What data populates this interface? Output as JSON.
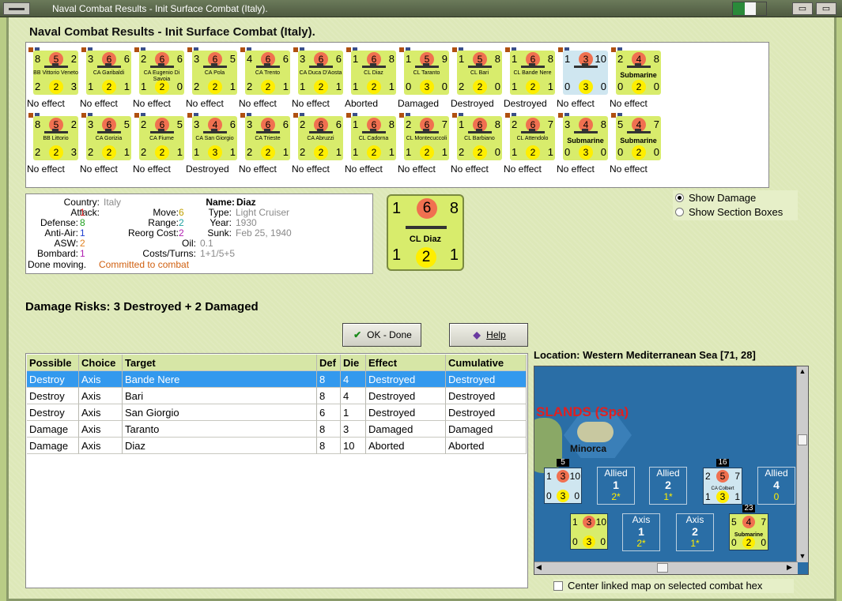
{
  "window": {
    "title": "Naval Combat Results - Init Surface Combat (Italy)."
  },
  "page": {
    "title": "Naval Combat Results - Init Surface Combat (Italy)."
  },
  "colors": {
    "accent": "#3399ee",
    "counter_axis": "#d8ec6c",
    "panel_bg": "#dde8b8"
  },
  "units": [
    {
      "name": "BB Vittorio Veneto",
      "tl": "8",
      "tc": "5",
      "tr": "2",
      "bl": "2",
      "bc": "2",
      "br": "3",
      "result": "No effect"
    },
    {
      "name": "CA Garibaldi",
      "tl": "3",
      "tc": "6",
      "tr": "6",
      "bl": "1",
      "bc": "2",
      "br": "1",
      "result": "No effect"
    },
    {
      "name": "CA Eugenio Di Savoia",
      "tl": "2",
      "tc": "6",
      "tr": "6",
      "bl": "1",
      "bc": "2",
      "br": "0",
      "result": "No effect"
    },
    {
      "name": "CA Pola",
      "tl": "3",
      "tc": "6",
      "tr": "5",
      "bl": "2",
      "bc": "2",
      "br": "1",
      "result": "No effect"
    },
    {
      "name": "CA Trento",
      "tl": "4",
      "tc": "6",
      "tr": "6",
      "bl": "2",
      "bc": "2",
      "br": "1",
      "result": "No effect"
    },
    {
      "name": "CA Duca D'Aosta",
      "tl": "3",
      "tc": "6",
      "tr": "6",
      "bl": "1",
      "bc": "2",
      "br": "1",
      "result": "No effect"
    },
    {
      "name": "CL Diaz",
      "tl": "1",
      "tc": "6",
      "tr": "8",
      "bl": "1",
      "bc": "2",
      "br": "1",
      "result": "Aborted"
    },
    {
      "name": "CL Taranto",
      "tl": "1",
      "tc": "5",
      "tr": "9",
      "bl": "0",
      "bc": "3",
      "br": "0",
      "result": "Damaged"
    },
    {
      "name": "CL Bari",
      "tl": "1",
      "tc": "5",
      "tr": "8",
      "bl": "2",
      "bc": "2",
      "br": "0",
      "result": "Destroyed"
    },
    {
      "name": "CL Bande Nere",
      "tl": "1",
      "tc": "6",
      "tr": "8",
      "bl": "1",
      "bc": "2",
      "br": "1",
      "result": "Destroyed"
    },
    {
      "name": "",
      "tl": "1",
      "tc": "3",
      "tr": "10",
      "bl": "0",
      "bc": "3",
      "br": "0",
      "result": "No effect"
    },
    {
      "name": "Submarine",
      "tl": "2",
      "tc": "4",
      "tr": "8",
      "bl": "0",
      "bc": "2",
      "br": "0",
      "result": "No effect"
    },
    {
      "name": "BB Littorio",
      "tl": "8",
      "tc": "5",
      "tr": "2",
      "bl": "2",
      "bc": "2",
      "br": "3",
      "result": "No effect"
    },
    {
      "name": "CA Gorizia",
      "tl": "3",
      "tc": "6",
      "tr": "5",
      "bl": "2",
      "bc": "2",
      "br": "1",
      "result": "No effect"
    },
    {
      "name": "CA Fiume",
      "tl": "2",
      "tc": "6",
      "tr": "5",
      "bl": "2",
      "bc": "2",
      "br": "1",
      "result": "No effect"
    },
    {
      "name": "CA San Giorgio",
      "tl": "3",
      "tc": "4",
      "tr": "6",
      "bl": "1",
      "bc": "3",
      "br": "1",
      "result": "Destroyed"
    },
    {
      "name": "CA Trieste",
      "tl": "3",
      "tc": "6",
      "tr": "6",
      "bl": "2",
      "bc": "2",
      "br": "1",
      "result": "No effect"
    },
    {
      "name": "CA Abruzzi",
      "tl": "2",
      "tc": "6",
      "tr": "6",
      "bl": "2",
      "bc": "2",
      "br": "1",
      "result": "No effect"
    },
    {
      "name": "CL Cadorna",
      "tl": "1",
      "tc": "6",
      "tr": "8",
      "bl": "1",
      "bc": "2",
      "br": "1",
      "result": "No effect"
    },
    {
      "name": "CL Montecuccoli",
      "tl": "2",
      "tc": "6",
      "tr": "7",
      "bl": "1",
      "bc": "2",
      "br": "1",
      "result": "No effect"
    },
    {
      "name": "CL Barbiano",
      "tl": "1",
      "tc": "6",
      "tr": "8",
      "bl": "2",
      "bc": "2",
      "br": "0",
      "result": "No effect"
    },
    {
      "name": "CL Attendolo",
      "tl": "2",
      "tc": "6",
      "tr": "7",
      "bl": "1",
      "bc": "2",
      "br": "1",
      "result": "No effect"
    },
    {
      "name": "Submarine",
      "tl": "3",
      "tc": "4",
      "tr": "8",
      "bl": "0",
      "bc": "3",
      "br": "0",
      "result": "No effect"
    },
    {
      "name": "Submarine",
      "tl": "5",
      "tc": "4",
      "tr": "7",
      "bl": "0",
      "bc": "2",
      "br": "0",
      "result": "No effect"
    }
  ],
  "info": {
    "country_label": "Country:",
    "country": "Italy",
    "attack_label": "Attack:",
    "attack": "1",
    "defense_label": "Defense:",
    "defense": "8",
    "antiair_label": "Anti-Air:",
    "antiair": "1",
    "asw_label": "ASW:",
    "asw": "2",
    "bombard_label": "Bombard:",
    "bombard": "1",
    "done_label": "Done moving.",
    "done_status": "Committed to combat",
    "name_label": "Name:",
    "name": "Diaz",
    "move_label": "Move:",
    "move": "6",
    "type_label": "Type:",
    "type": "Light Cruiser",
    "range_label": "Range:",
    "range": "2",
    "year_label": "Year:",
    "year": "1930",
    "reorg_label": "Reorg Cost:",
    "reorg": "2",
    "sunk_label": "Sunk:",
    "sunk": "Feb 25, 1940",
    "oil_label": "Oil:",
    "oil": "0.1",
    "costs_label": "Costs/Turns:",
    "costs": "1+1/5+5"
  },
  "big_counter": {
    "tl": "1",
    "tc": "6",
    "tr": "8",
    "name": "CL Diaz",
    "bl": "1",
    "bc": "2",
    "br": "1"
  },
  "options": {
    "show_damage": "Show Damage",
    "show_sections": "Show Section Boxes"
  },
  "risks": "Damage Risks: 3 Destroyed + 2 Damaged",
  "buttons": {
    "ok": "OK - Done",
    "help": "Help"
  },
  "table": {
    "headers": [
      "Possible",
      "Choice",
      "Target",
      "Def",
      "Die",
      "Effect",
      "Cumulative"
    ],
    "rows": [
      [
        "Destroy",
        "Axis",
        "Bande Nere",
        "8",
        "4",
        "Destroyed",
        "Destroyed"
      ],
      [
        "Destroy",
        "Axis",
        "Bari",
        "8",
        "4",
        "Destroyed",
        "Destroyed"
      ],
      [
        "Destroy",
        "Axis",
        "San Giorgio",
        "6",
        "1",
        "Destroyed",
        "Destroyed"
      ],
      [
        "Damage",
        "Axis",
        "Taranto",
        "8",
        "3",
        "Damaged",
        "Damaged"
      ],
      [
        "Damage",
        "Axis",
        "Diaz",
        "8",
        "10",
        "Aborted",
        "Aborted"
      ]
    ]
  },
  "location": "Location:  Western Mediterranean Sea [71, 28]",
  "map": {
    "region_label": "SLANDS (Spa)",
    "island_label": "Minorca",
    "stack_1": "5",
    "stack_2": "16",
    "stack_3": "23",
    "unit_a": {
      "tl": "1",
      "tc": "3",
      "tr": "10",
      "bl": "0",
      "bc": "3",
      "br": "0"
    },
    "unit_b": {
      "tl": "2",
      "tc": "5",
      "tr": "7",
      "name": "CA Colbert",
      "bl": "1",
      "bc": "3",
      "br": "1"
    },
    "unit_c": {
      "tl": "1",
      "tc": "3",
      "tr": "10",
      "bl": "0",
      "bc": "3",
      "br": "0"
    },
    "unit_d": {
      "tl": "5",
      "tc": "4",
      "tr": "7",
      "name": "Submarine",
      "bl": "0",
      "bc": "2",
      "br": "0"
    },
    "allied": [
      {
        "side": "Allied",
        "count": "1",
        "sub": "2*"
      },
      {
        "side": "Allied",
        "count": "2",
        "sub": "1*"
      },
      {
        "side": "Allied",
        "count": "4",
        "sub": "0"
      }
    ],
    "axis": [
      {
        "side": "Axis",
        "count": "1",
        "sub": "2*"
      },
      {
        "side": "Axis",
        "count": "2",
        "sub": "1*"
      }
    ]
  },
  "center_map_label": "Center linked map on selected combat hex"
}
